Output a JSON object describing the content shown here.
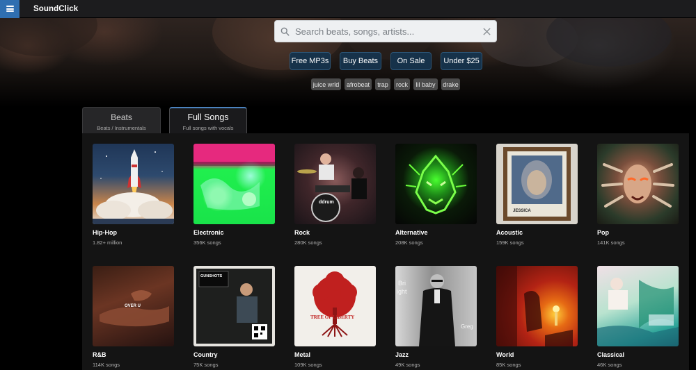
{
  "app": {
    "name": "SoundClick"
  },
  "search": {
    "placeholder": "Search beats, songs, artists..."
  },
  "quick_filters": [
    "Free MP3s",
    "Buy Beats",
    "On Sale",
    "Under $25"
  ],
  "tags": [
    "juice wrld",
    "afrobeat",
    "trap",
    "rock",
    "lil baby",
    "drake"
  ],
  "tabs": [
    {
      "title": "Beats",
      "subtitle": "Beats / Instrumentals",
      "active": false
    },
    {
      "title": "Full Songs",
      "subtitle": "Full songs with vocals",
      "active": true
    }
  ],
  "genres": [
    {
      "name": "Hip-Hop",
      "count": "1.82+ million"
    },
    {
      "name": "Electronic",
      "count": "356K songs"
    },
    {
      "name": "Rock",
      "count": "280K songs"
    },
    {
      "name": "Alternative",
      "count": "208K songs"
    },
    {
      "name": "Acoustic",
      "count": "159K songs"
    },
    {
      "name": "Pop",
      "count": "141K songs"
    },
    {
      "name": "R&B",
      "count": "114K songs"
    },
    {
      "name": "Country",
      "count": "75K songs"
    },
    {
      "name": "Metal",
      "count": "109K songs"
    },
    {
      "name": "Jazz",
      "count": "49K songs"
    },
    {
      "name": "World",
      "count": "85K songs"
    },
    {
      "name": "Classical",
      "count": "46K songs"
    }
  ],
  "cover_text": {
    "acoustic": "JESSICA",
    "rnb": "OVER U",
    "country": "GUNSHOTS",
    "metal": "TREE OF LIBERTY",
    "rock": "ddrum",
    "jazz_left": "Bri",
    "jazz_left2": "ight",
    "jazz_right": "Greg"
  },
  "colors": {
    "accent": "#2f6fb1",
    "chip_bg": "#16324a",
    "tag_bg": "#4a4a4a",
    "panel_bg": "#141414"
  }
}
